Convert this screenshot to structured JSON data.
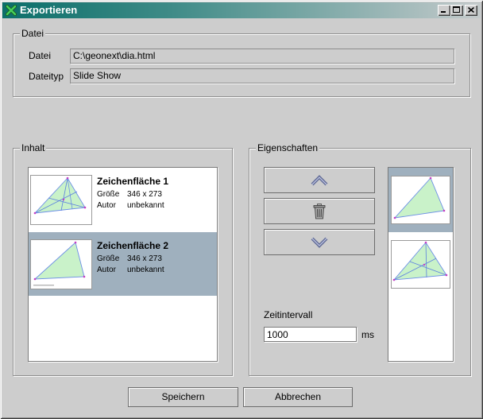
{
  "window": {
    "title": "Exportieren",
    "app_icon": "geonext-x-icon",
    "controls": [
      "minimize-icon",
      "maximize-icon",
      "close-icon"
    ]
  },
  "datei": {
    "title": "Datei",
    "file_label": "Datei",
    "file_value": "C:\\geonext\\dia.html",
    "type_label": "Dateityp",
    "type_value": "Slide Show"
  },
  "inhalt": {
    "title": "Inhalt",
    "selected_index": 1,
    "items": [
      {
        "title": "Zeichenfläche 1",
        "size_label": "Größe",
        "size_value": "346 x 273",
        "author_label": "Autor",
        "author_value": "unbekannt"
      },
      {
        "title": "Zeichenfläche 2",
        "size_label": "Größe",
        "size_value": "346 x 273",
        "author_label": "Autor",
        "author_value": "unbekannt"
      }
    ]
  },
  "eigenschaften": {
    "title": "Eigenschaften",
    "icons": {
      "move_up": "chevron-up-icon",
      "delete": "trash-icon",
      "move_down": "chevron-down-icon"
    },
    "interval_label": "Zeitintervall",
    "interval_value": "1000",
    "interval_unit": "ms",
    "preview_selected_index": 0
  },
  "buttons": {
    "save": "Speichern",
    "cancel": "Abbrechen"
  },
  "colors": {
    "background": "#cdcdcd",
    "selection": "#9fb0be",
    "titlebar_start": "#0b6f6a",
    "titlebar_end": "#c4cacb",
    "thumbnail_fill": "#c9f2c9"
  }
}
